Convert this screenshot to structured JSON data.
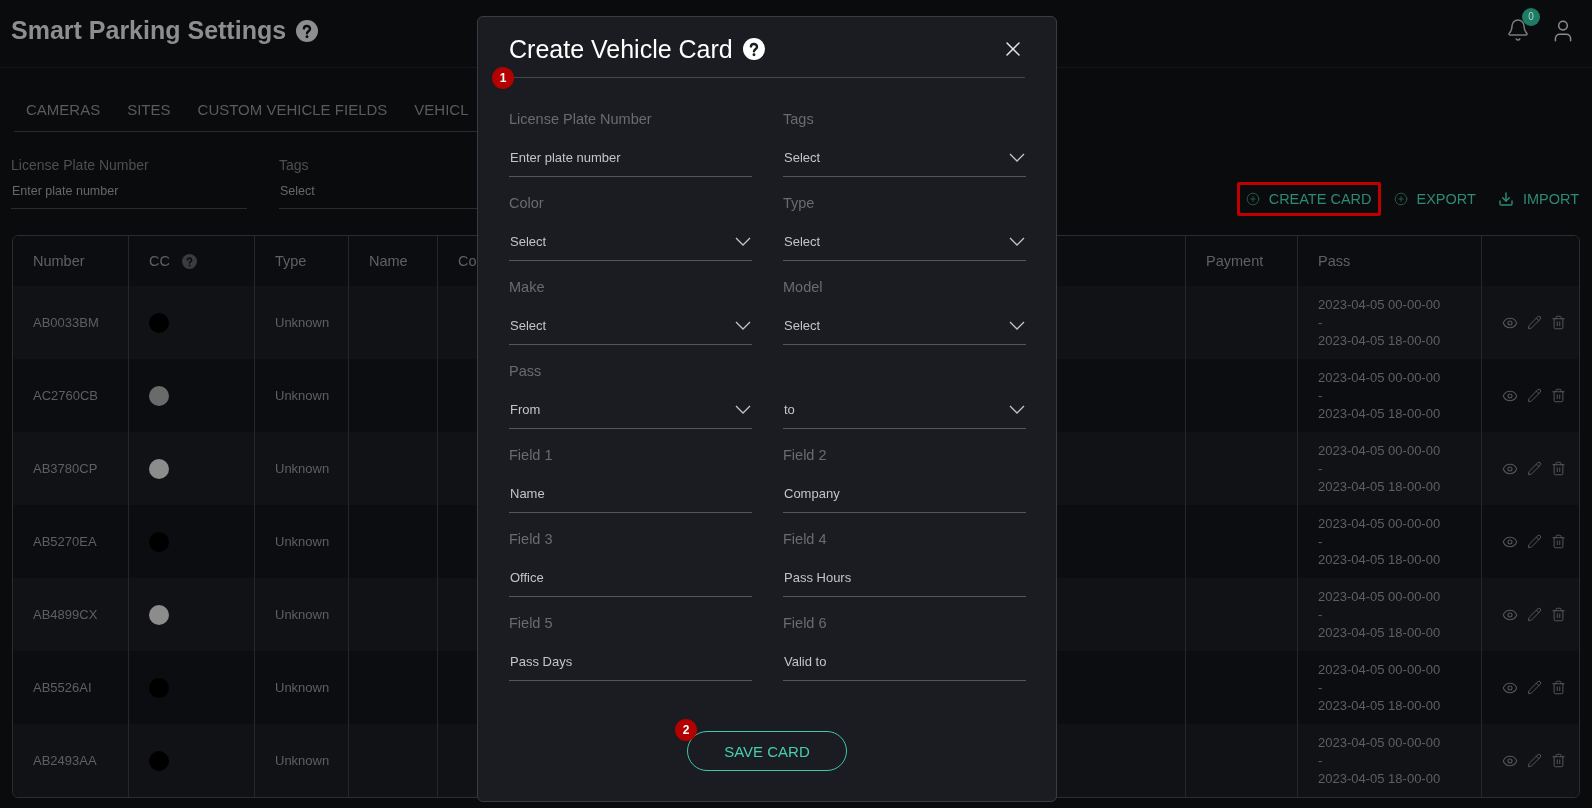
{
  "page": {
    "title": "Smart Parking Settings"
  },
  "notifications": {
    "count": "0"
  },
  "tabs": [
    {
      "label": "CAMERAS",
      "selected": false
    },
    {
      "label": "SITES",
      "selected": false
    },
    {
      "label": "CUSTOM VEHICLE FIELDS",
      "selected": false
    },
    {
      "label": "VEHICL",
      "selected": false
    }
  ],
  "filters": [
    {
      "label": "License Plate Number",
      "kind": "input",
      "placeholder": "Enter plate number"
    },
    {
      "label": "Tags",
      "kind": "select",
      "placeholder": "Select"
    }
  ],
  "actions": [
    {
      "label": "CREATE CARD",
      "kind": "create",
      "highlighted": true
    },
    {
      "label": "EXPORT",
      "kind": "export",
      "highlighted": false
    },
    {
      "label": "IMPORT",
      "kind": "import",
      "highlighted": false
    }
  ],
  "table": {
    "columns": [
      {
        "label": "Number"
      },
      {
        "label": "CC",
        "help": true
      },
      {
        "label": "Type"
      },
      {
        "label": "Name"
      },
      {
        "label": "Co"
      },
      {
        "label": "Payment"
      },
      {
        "label": "Pass"
      }
    ],
    "rows": [
      {
        "number": "AB0033BM",
        "color": "#000000",
        "type": "Unknown",
        "pass": [
          "2023-04-05 00-00-00",
          "-",
          "2023-04-05 18-00-00"
        ]
      },
      {
        "number": "AC2760CB",
        "color": "#6a6a6a",
        "type": "Unknown",
        "pass": [
          "2023-04-05 00-00-00",
          "-",
          "2023-04-05 18-00-00"
        ]
      },
      {
        "number": "AB3780CP",
        "color": "#8c8c8c",
        "type": "Unknown",
        "pass": [
          "2023-04-05 00-00-00",
          "-",
          "2023-04-05 18-00-00"
        ]
      },
      {
        "number": "AB5270EA",
        "color": "#000000",
        "type": "Unknown",
        "pass": [
          "2023-04-05 00-00-00",
          "-",
          "2023-04-05 18-00-00"
        ]
      },
      {
        "number": "AB4899CX",
        "color": "#8c8c8c",
        "type": "Unknown",
        "pass": [
          "2023-04-05 00-00-00",
          "-",
          "2023-04-05 18-00-00"
        ]
      },
      {
        "number": "AB5526AI",
        "color": "#000000",
        "type": "Unknown",
        "pass": [
          "2023-04-05 00-00-00",
          "-",
          "2023-04-05 18-00-00"
        ]
      },
      {
        "number": "AB2493AA",
        "color": "#000000",
        "type": "Unknown",
        "pass": [
          "2023-04-05 00-00-00",
          "-",
          "2023-04-05 18-00-00"
        ]
      }
    ]
  },
  "dialog": {
    "title": "Create Vehicle Card",
    "fields": [
      {
        "label": "License Plate Number",
        "kind": "input",
        "placeholder": "Enter plate number"
      },
      {
        "label": "Tags",
        "kind": "select",
        "placeholder": "Select"
      },
      {
        "label": "Color",
        "kind": "select",
        "placeholder": "Select"
      },
      {
        "label": "Type",
        "kind": "select",
        "placeholder": "Select"
      },
      {
        "label": "Make",
        "kind": "select",
        "placeholder": "Select"
      },
      {
        "label": "Model",
        "kind": "select",
        "placeholder": "Select"
      },
      {
        "label": "Pass",
        "kind": "select",
        "placeholder": "From"
      },
      {
        "kind": "select",
        "placeholder": "to"
      },
      {
        "label": "Field 1",
        "kind": "input",
        "placeholder": "Name"
      },
      {
        "label": "Field 2",
        "kind": "input",
        "placeholder": "Company"
      },
      {
        "label": "Field 3",
        "kind": "input",
        "placeholder": "Office"
      },
      {
        "label": "Field 4",
        "kind": "input",
        "placeholder": "Pass Hours"
      },
      {
        "label": "Field 5",
        "kind": "input",
        "placeholder": "Pass Days"
      },
      {
        "label": "Field 6",
        "kind": "input",
        "placeholder": "Valid to"
      }
    ],
    "save_label": "SAVE CARD",
    "markers": [
      {
        "label": "1",
        "kind": "title"
      },
      {
        "label": "2",
        "kind": "save"
      }
    ]
  }
}
